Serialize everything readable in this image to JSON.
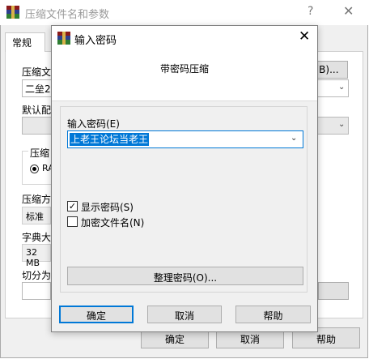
{
  "background_window": {
    "title": "压缩文件名和参数",
    "help_glyph": "?",
    "close_glyph": "✕",
    "tab_general": "常规",
    "archive_name_label": "压缩文",
    "archive_name_value": "二垒2",
    "browse_button": "(B)...",
    "default_profile_label": "默认配",
    "format_group_label": "压缩",
    "format_radio_label": "RA",
    "method_label": "压缩方",
    "method_value": "标准",
    "dict_label": "字典大",
    "dict_value": "32 MB",
    "split_label": "切分为",
    "ok_button": "确定",
    "cancel_button": "取消",
    "help_button": "帮助"
  },
  "dialog": {
    "title": "输入密码",
    "close_glyph": "✕",
    "subtitle": "带密码压缩",
    "password_label": "输入密码(E)",
    "password_value": "上老王论坛当老王",
    "show_password_label": "显示密码(S)",
    "show_password_checked": true,
    "encrypt_names_label": "加密文件名(N)",
    "encrypt_names_checked": false,
    "organize_button": "整理密码(O)...",
    "ok_button": "确定",
    "cancel_button": "取消",
    "help_button": "帮助",
    "check_glyph": "✓"
  },
  "icons": {
    "dropdown": "⌄"
  },
  "colors": {
    "accent": "#0078d7",
    "button_face": "#e1e1e1",
    "window_face": "#f0f0f0"
  }
}
